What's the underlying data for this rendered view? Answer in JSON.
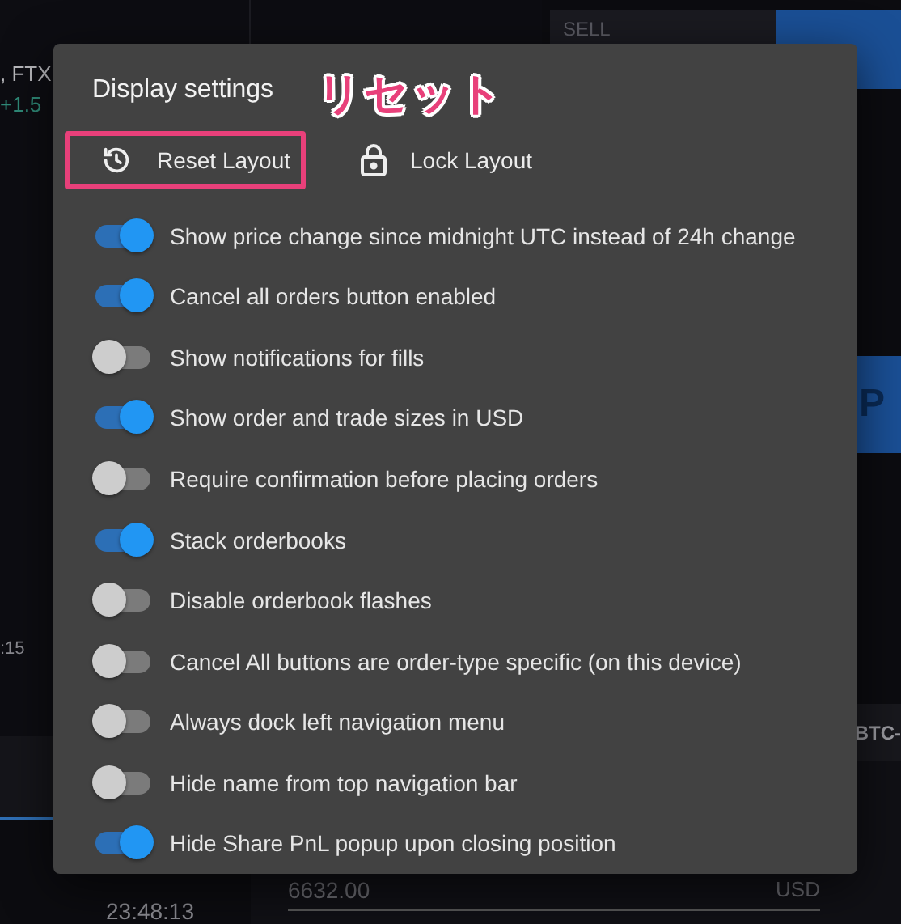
{
  "background": {
    "market": ", FTX",
    "change": "+1.5",
    "time_tick": ":15",
    "sell_tab": "SELL",
    "buy_banner": "P",
    "pair": "BTC-",
    "price_input": "6632.00",
    "currency": "USD",
    "trade_time": "23:48:13"
  },
  "dialog": {
    "title": "Display settings",
    "actions": [
      {
        "kind": "reset",
        "label": "Reset Layout",
        "highlighted": true
      },
      {
        "kind": "lock",
        "label": "Lock Layout",
        "highlighted": false
      }
    ],
    "settings": [
      {
        "label": "Show price change since midnight UTC instead of 24h change",
        "on": true
      },
      {
        "label": "Cancel all orders button enabled",
        "on": true
      },
      {
        "label": "Show notifications for fills",
        "on": false
      },
      {
        "label": "Show order and trade sizes in USD",
        "on": true
      },
      {
        "label": "Require confirmation before placing orders",
        "on": false
      },
      {
        "label": "Stack orderbooks",
        "on": true
      },
      {
        "label": "Disable orderbook flashes",
        "on": false
      },
      {
        "label": "Cancel All buttons are order-type specific (on this device)",
        "on": false
      },
      {
        "label": "Always dock left navigation menu",
        "on": false
      },
      {
        "label": "Hide name from top navigation bar",
        "on": false
      },
      {
        "label": "Hide Share PnL popup upon closing position",
        "on": true
      }
    ]
  },
  "annotation": {
    "text": "リセット"
  }
}
